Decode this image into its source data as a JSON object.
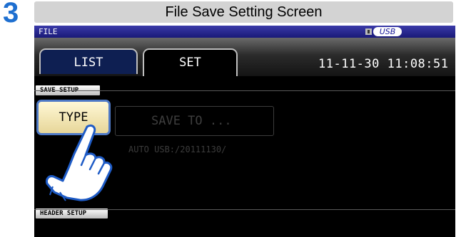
{
  "step": "3",
  "caption": "File Save Setting Screen",
  "window": {
    "title": "FILE",
    "usb_label": "USB"
  },
  "tabs": [
    {
      "label": "LIST",
      "active": false
    },
    {
      "label": "SET",
      "active": true
    }
  ],
  "datetime": "11-11-30 11:08:51",
  "save_setup": {
    "section_label": "SAVE SETUP",
    "type_button": "TYPE",
    "save_to_button": "SAVE TO ...",
    "mode_path": "AUTO  USB:/20111130/"
  },
  "header_setup": {
    "section_label": "HEADER SETUP"
  },
  "colors": {
    "step_number": "#1e6fd0",
    "type_button_border": "#4e79c6",
    "type_button_fill": "#efe1a9",
    "list_tab_fill": "#0e1f52",
    "titlebar": "#2a2a90"
  },
  "icons": [
    "usb-icon",
    "pointing-hand-icon"
  ]
}
